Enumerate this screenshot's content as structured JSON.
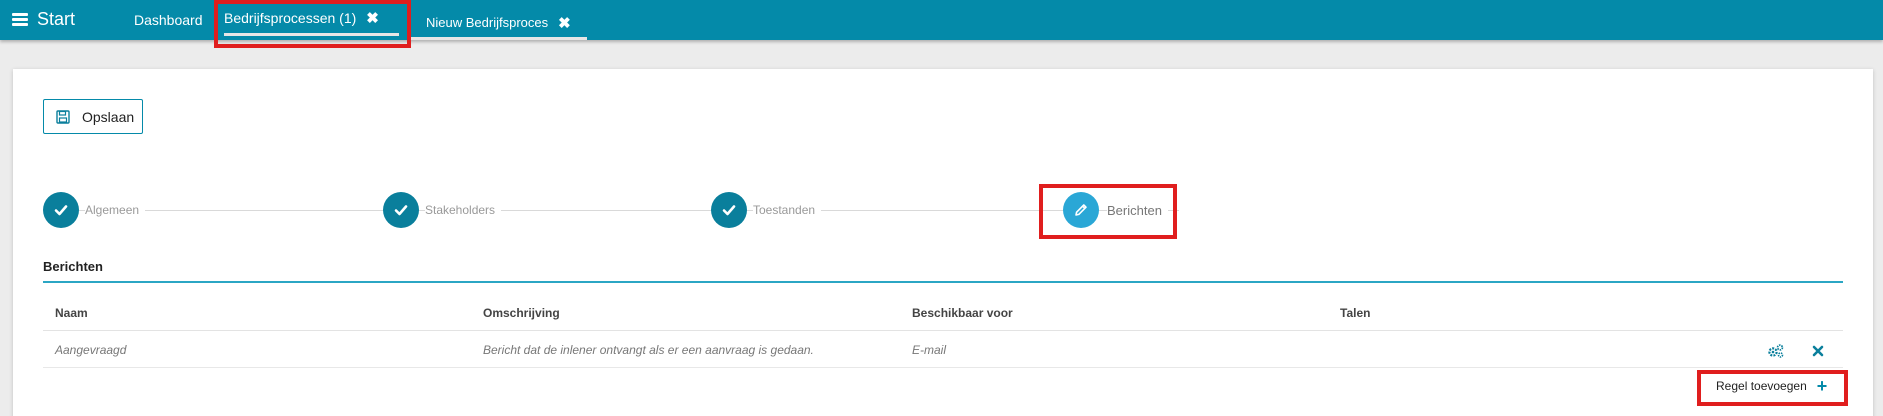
{
  "topbar": {
    "start_label": "Start",
    "tabs": [
      {
        "label": "Dashboard"
      },
      {
        "label": "Bedrijfsprocessen (1)"
      },
      {
        "label": "Nieuw Bedrijfsproces"
      }
    ],
    "close_glyph": "✖",
    "background_color": "#048aa9"
  },
  "toolbar": {
    "save_label": "Opslaan",
    "save_icon": "floppy-disk-icon"
  },
  "stepper": {
    "steps": [
      {
        "label": "Algemeen",
        "state": "completed",
        "icon": "check-icon"
      },
      {
        "label": "Stakeholders",
        "state": "completed",
        "icon": "check-icon"
      },
      {
        "label": "Toestanden",
        "state": "completed",
        "icon": "check-icon"
      },
      {
        "label": "Berichten",
        "state": "active",
        "icon": "pencil-icon"
      }
    ]
  },
  "section": {
    "title": "Berichten"
  },
  "table": {
    "columns": [
      "Naam",
      "Omschrijving",
      "Beschikbaar voor",
      "Talen"
    ],
    "rows": [
      {
        "naam": "Aangevraagd",
        "omschrijving": "Bericht dat de inlener ontvangt als er een aanvraag is gedaan.",
        "beschikbaar_voor": "E-mail",
        "talen": "",
        "actions": [
          "settings-gears-icon",
          "delete-x-icon"
        ]
      }
    ],
    "add_row_label": "Regel toevoegen",
    "add_row_icon": "plus-icon"
  },
  "colors": {
    "accent": "#048aa9",
    "step_completed": "#0a7f9c",
    "step_active": "#2aa7d6",
    "highlight": "#e01e1e"
  }
}
